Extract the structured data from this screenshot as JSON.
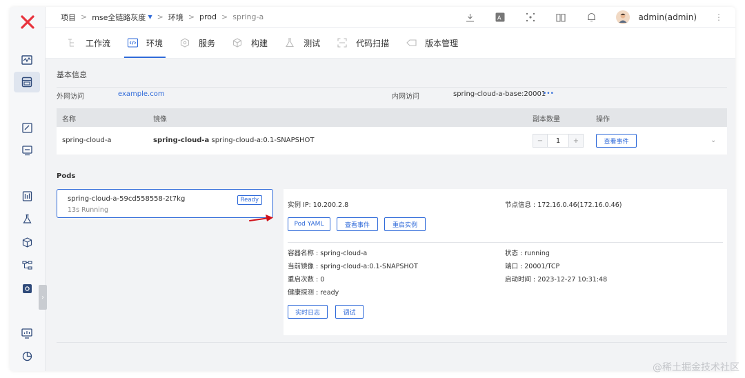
{
  "breadcrumb": {
    "items": [
      "项目",
      "mse全链路灰度",
      "环境",
      "prod",
      "spring-a"
    ]
  },
  "header": {
    "user": "admin(admin)"
  },
  "tabs": [
    {
      "label": "工作流",
      "active": false
    },
    {
      "label": "环境",
      "active": true
    },
    {
      "label": "服务",
      "active": false
    },
    {
      "label": "构建",
      "active": false
    },
    {
      "label": "测试",
      "active": false
    },
    {
      "label": "代码扫描",
      "active": false
    },
    {
      "label": "版本管理",
      "active": false
    }
  ],
  "basic_info": {
    "title": "基本信息",
    "external_label": "外网访问",
    "external_value": "example.com",
    "internal_label": "内网访问",
    "internal_value": "spring-cloud-a-base:20001",
    "more": "•••"
  },
  "service_table": {
    "headers": {
      "name": "名称",
      "image": "镜像",
      "replicas": "副本数量",
      "actions": "操作"
    },
    "row": {
      "name": "spring-cloud-a",
      "image_bold": "spring-cloud-a",
      "image_rest": "spring-cloud-a:0.1-SNAPSHOT",
      "minus": "−",
      "replicas": "1",
      "plus": "+",
      "events_button": "查看事件"
    }
  },
  "pods": {
    "title": "Pods",
    "card": {
      "name": "spring-cloud-a-59cd558558-2t7kg",
      "status": "13s  Running",
      "badge": "Ready"
    },
    "detail": {
      "instance_ip": "实例 IP: 10.200.2.8",
      "node_info": "节点信息 : 172.16.0.46(172.16.0.46)",
      "btn_yaml": "Pod YAML",
      "btn_events": "查看事件",
      "btn_restart": "重启实例",
      "container_name": "容器名称 : spring-cloud-a",
      "current_image": "当前镜像 : spring-cloud-a:0.1-SNAPSHOT",
      "restart_count": "重启次数 : 0",
      "health_check": "健康探测 : ready",
      "state": "状态 : running",
      "port": "端口 : 20001/TCP",
      "start_time": "启动时间 : 2023-12-27 10:31:48",
      "btn_logs": "实时日志",
      "btn_debug": "调试"
    }
  },
  "watermark": "@稀土掘金技术社区",
  "colors": {
    "accent": "#2f6ad9",
    "arrow": "#d0121b",
    "logo": "#e8333d"
  }
}
